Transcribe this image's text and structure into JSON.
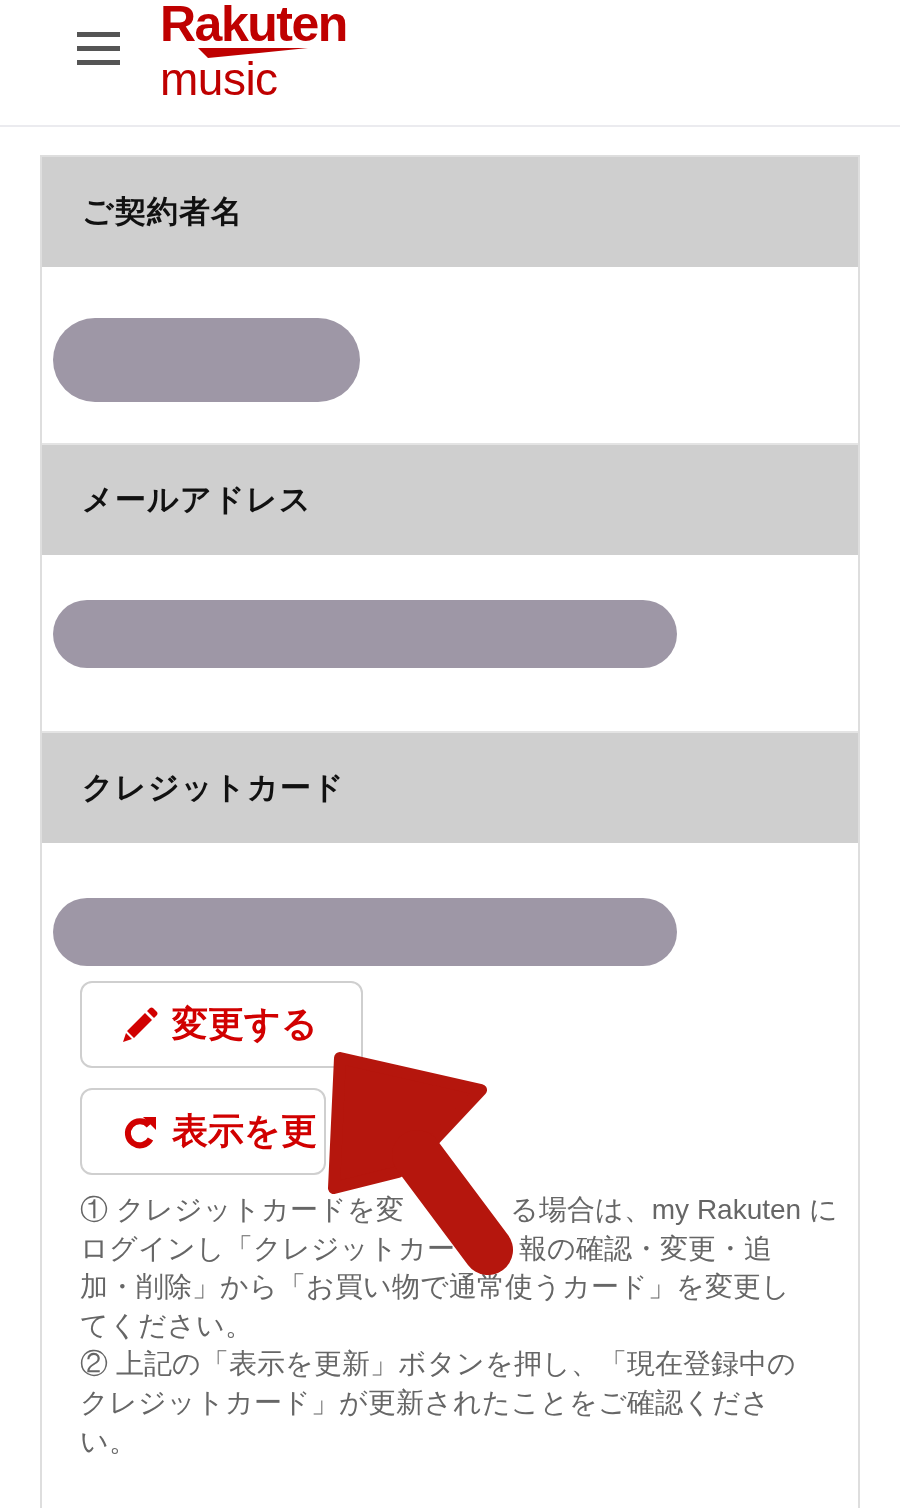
{
  "header": {
    "logo": {
      "brand": "Rakuten",
      "product": "music"
    }
  },
  "sections": [
    {
      "kind": "name",
      "title": "ご契約者名"
    },
    {
      "kind": "email",
      "title": "メールアドレス"
    },
    {
      "kind": "card",
      "title": "クレジットカード",
      "buttons": [
        {
          "kind": "edit",
          "label": "変更する"
        },
        {
          "kind": "refresh",
          "label": "表示を更"
        }
      ],
      "notes": [
        {
          "lines": [
            [
              "① クレジットカードを変",
              "る場合は、my Rakuten に"
            ],
            [
              "ログインし「クレジットカー",
              "報の確認・変更・追"
            ],
            [
              "加・削除」から「お買い物で通常使うカード」を変更し"
            ],
            [
              "てください。"
            ]
          ]
        },
        {
          "lines": [
            [
              "② 上記の「表示を更新」ボタンを押し、「現在登録中の"
            ],
            [
              "クレジットカード」が更新されたことをご確認くださ"
            ],
            [
              "い。"
            ]
          ]
        }
      ]
    }
  ]
}
